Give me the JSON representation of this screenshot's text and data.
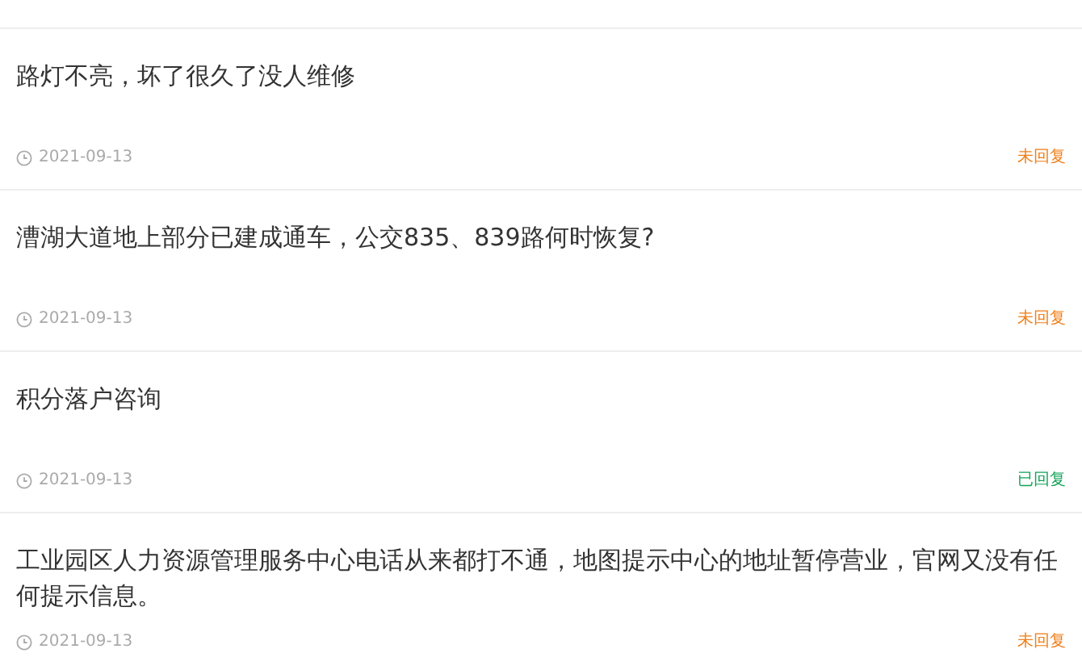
{
  "questions": [
    {
      "title": "路灯不亮，坏了很久了没人维修",
      "date": "2021-09-13",
      "status": "未回复",
      "replied": false
    },
    {
      "title": "漕湖大道地上部分已建成通车，公交835、839路何时恢复?",
      "date": "2021-09-13",
      "status": "未回复",
      "replied": false
    },
    {
      "title": "积分落户咨询",
      "date": "2021-09-13",
      "status": "已回复",
      "replied": true
    },
    {
      "title": "工业园区人力资源管理服务中心电话从来都打不通，地图提示中心的地址暂停营业，官网又没有任何提示信息。",
      "date": "2021-09-13",
      "status": "未回复",
      "replied": false
    }
  ]
}
